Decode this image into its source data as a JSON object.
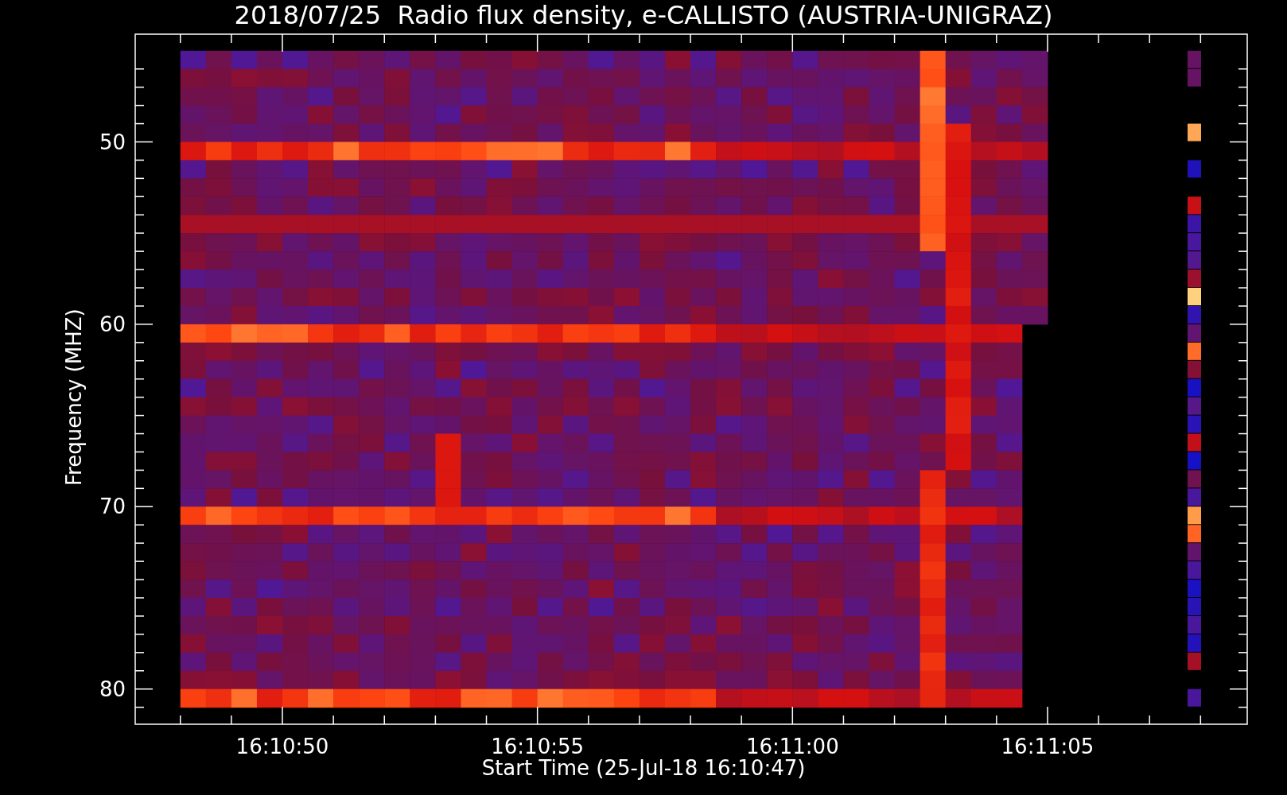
{
  "title": "2018/07/25  Radio flux density, e-CALLISTO (AUSTRIA-UNIGRAZ)",
  "y_axis": {
    "label": "Frequency (MHZ)",
    "ticks": [
      "50",
      "60",
      "70",
      "80"
    ]
  },
  "x_axis": {
    "label": "Start Time (25-Jul-18 16:10:47)",
    "ticks": [
      "16:10:50",
      "16:10:55",
      "16:11:00",
      "16:11:05"
    ]
  }
}
